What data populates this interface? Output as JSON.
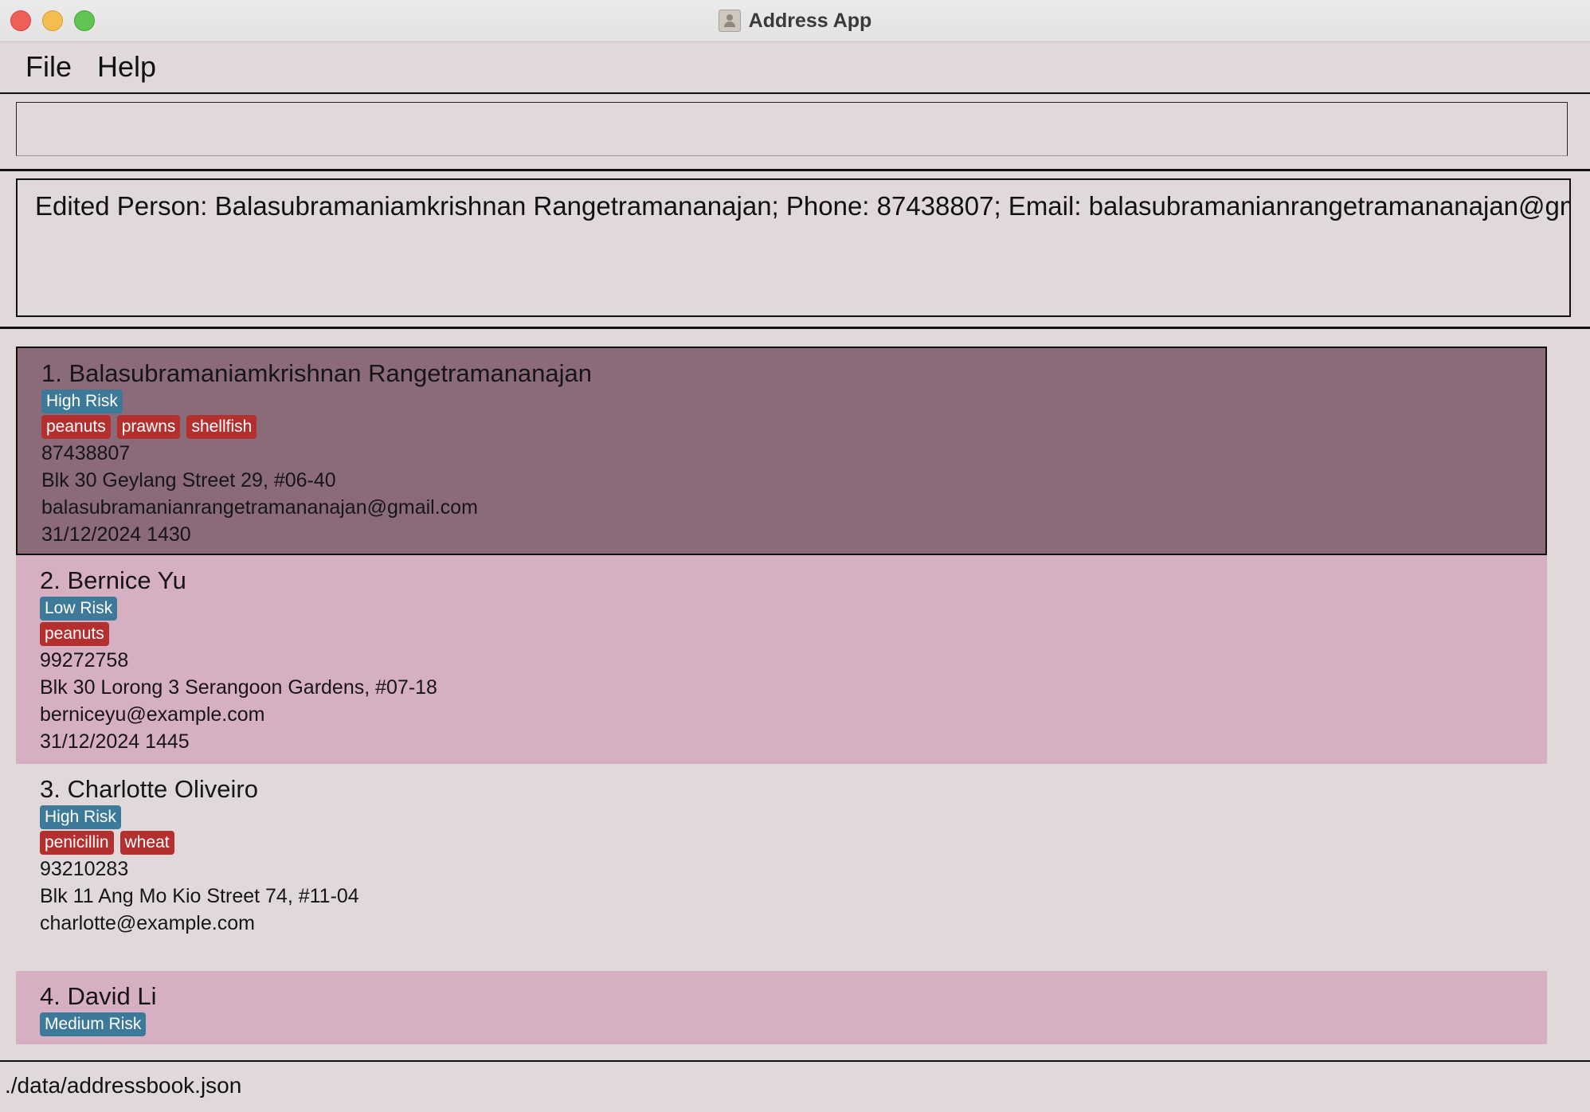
{
  "window": {
    "title": "Address App"
  },
  "menu": {
    "file": "File",
    "help": "Help"
  },
  "command": {
    "value": ""
  },
  "result": {
    "text": "Edited Person: Balasubramaniamkrishnan Rangetramananajan; Phone: 87438807; Email: balasubramanianrangetramananajan@gmail.com"
  },
  "persons": [
    {
      "name": "1. Balasubramaniamkrishnan Rangetramananajan",
      "risk": "High Risk",
      "allergies": [
        "peanuts",
        "prawns",
        "shellfish"
      ],
      "phone": "87438807",
      "address": "Blk 30 Geylang Street 29, #06-40",
      "email": "balasubramanianrangetramananajan@gmail.com",
      "appointment": "31/12/2024 1430"
    },
    {
      "name": "2. Bernice Yu",
      "risk": "Low Risk",
      "allergies": [
        "peanuts"
      ],
      "phone": "99272758",
      "address": "Blk 30 Lorong 3 Serangoon Gardens, #07-18",
      "email": "berniceyu@example.com",
      "appointment": "31/12/2024 1445"
    },
    {
      "name": "3. Charlotte Oliveiro",
      "risk": "High Risk",
      "allergies": [
        "penicillin",
        "wheat"
      ],
      "phone": "93210283",
      "address": "Blk 11 Ang Mo Kio Street 74, #11-04",
      "email": "charlotte@example.com"
    },
    {
      "name": "4. David Li",
      "risk": "Medium Risk"
    }
  ],
  "status": {
    "path": "./data/addressbook.json"
  },
  "colors": {
    "background": "#e1d9d9",
    "selected_card": "#8b6b7a",
    "alternate_card": "#d7afc2",
    "risk_tag": "#3d7a9a",
    "allergy_tag": "#b4302f"
  }
}
